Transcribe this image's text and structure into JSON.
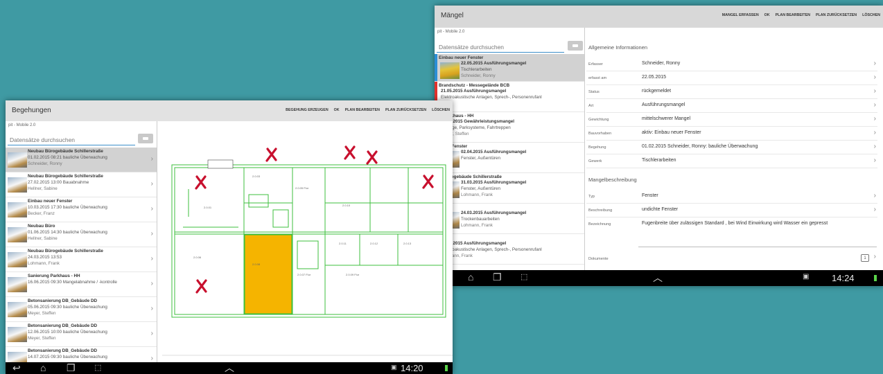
{
  "maengel": {
    "title": "Mängel",
    "actions": [
      "MANGEL ERFASSEN",
      "OK",
      "PLAN BEARBEITEN",
      "PLAN ZURÜCKSETZEN",
      "LÖSCHEN"
    ],
    "subtitle": "pit - Mobile 2.0",
    "search_placeholder": "Datensätze durchsuchen",
    "list": [
      {
        "title": "Einbau neuer Fenster",
        "line2": "22.05.2015  Ausführungsmangel",
        "line3": "Tischlerarbeiten",
        "line4": "Schneider, Ronny",
        "color": "#2c8ed6",
        "selected": true
      },
      {
        "title": "Brandschutz - Messegelände BCB",
        "line2": "21.05.2015  Ausführungsmangel",
        "line3": "Elektroakustische Anlagen, Sprech-, Personenrufanl",
        "line4": "",
        "color": "#e0322d"
      },
      {
        "title": "ung Parkhaus - HH",
        "line2": "15.04.2015  Gewährleistungsmangel",
        "line3": "Aufzüge, Parksysteme, Fahrtreppen",
        "line4": "Meyer, Steffen",
        "color": ""
      },
      {
        "title": "u neuer Fenster",
        "line2": "02.04.2015  Ausführungsmangel",
        "line3": "Fenster, Außentüren",
        "line4": "",
        "color": ""
      },
      {
        "title": "bau Bürogebäude Schillerstraße",
        "line2": "31.03.2015  Ausführungsmangel",
        "line3": "Fenster, Außentüren",
        "line4": "Lohmann, Frank",
        "color": ""
      },
      {
        "title": "au Büro",
        "line2": "24.03.2015  Ausführungsmangel",
        "line3": "Trockenbauarbeiten",
        "line4": "Lohmann, Frank",
        "color": ""
      },
      {
        "title": "au Büro",
        "line2": "23.03.2015  Ausführungsmangel",
        "line3": "Elektroakustische Anlagen, Sprech-, Personenrufanl",
        "line4": "Lohmann, Frank",
        "color": ""
      }
    ],
    "detail": {
      "section1": "Allgemeine Informationen",
      "rows1": [
        {
          "label": "Erfasser",
          "value": "Schneider, Ronny"
        },
        {
          "label": "erfasst am",
          "value": "22.05.2015"
        },
        {
          "label": "Status",
          "value": "rückgemeldet"
        },
        {
          "label": "Art",
          "value": "Ausführungsmangel"
        },
        {
          "label": "Gewichtung",
          "value": "mittelschwerer Mangel"
        },
        {
          "label": "Bauvorhaben",
          "value": "aktiv: Einbau neuer Fenster"
        },
        {
          "label": "Begehung",
          "value": "01.02.2015  Schneider, Ronny: bauliche Überwachung"
        },
        {
          "label": "Gewerk",
          "value": "Tischlerarbeiten"
        }
      ],
      "section2": "Mangelbeschreibung",
      "rows2": [
        {
          "label": "Typ",
          "value": "Fenster"
        },
        {
          "label": "Beschreibung",
          "value": "undichte Fenster"
        },
        {
          "label": "Bezeichnung",
          "value": "Fugenbreite über zulässigen Standard , bei Wind Einwirkung wird Wasser ein gepresst"
        }
      ],
      "documents_label": "Dokumente",
      "documents_count": "1"
    },
    "clock": "14:24"
  },
  "begehungen": {
    "title": "Begehungen",
    "actions": [
      "BEGEHUNG ERZEUGEN",
      "OK",
      "PLAN BEARBEITEN",
      "PLAN ZURÜCKSETZEN",
      "LÖSCHEN"
    ],
    "subtitle": "pit - Mobile 2.0",
    "search_placeholder": "Datensätze durchsuchen",
    "list": [
      {
        "title": "Neubau Bürogebäude Schillerstraße",
        "line2": "01.02.2015 08:21 bauliche Überwachung",
        "line3": "Schneider, Ronny",
        "selected": true
      },
      {
        "title": "Neubau Bürogebäude Schillerstraße",
        "line2": "27.02.2015 13:00 Bauabnahme",
        "line3": "Hellner, Sabine"
      },
      {
        "title": "Einbau neuer Fenster",
        "line2": "10.03.2015 17:30 bauliche Überwachung",
        "line3": "Becker, Franz"
      },
      {
        "title": "Neubau Büro",
        "line2": "01.06.2015 14:30 bauliche Überwachung",
        "line3": "Hellner, Sabine"
      },
      {
        "title": "Neubau Bürogebäude Schillerstraße",
        "line2": "24.03.2015 13:53",
        "line3": "Lohmann, Frank"
      },
      {
        "title": "Sanierung Parkhaus - HH",
        "line2": "16.06.2015 09:30 Mangelabnahme / -kontrolle",
        "line3": ""
      },
      {
        "title": "Betonsanierung DB_Gebäude DD",
        "line2": "05.06.2015 09:30 bauliche Überwachung",
        "line3": "Meyer, Steffen"
      },
      {
        "title": "Betonsanierung DB_Gebäude DD",
        "line2": "12.06.2015 10:00 bauliche Überwachung",
        "line3": "Meyer, Steffen"
      },
      {
        "title": "Betonsanierung DB_Gebäude DD",
        "line2": "14.07.2015 09:30 bauliche Überwachung",
        "line3": ""
      }
    ],
    "clock": "14:20"
  },
  "colors": {
    "accent": "#3a8ec9",
    "highlight_room": "#f5b400",
    "mark": "#c8102e",
    "background": "#3f9aa3"
  }
}
